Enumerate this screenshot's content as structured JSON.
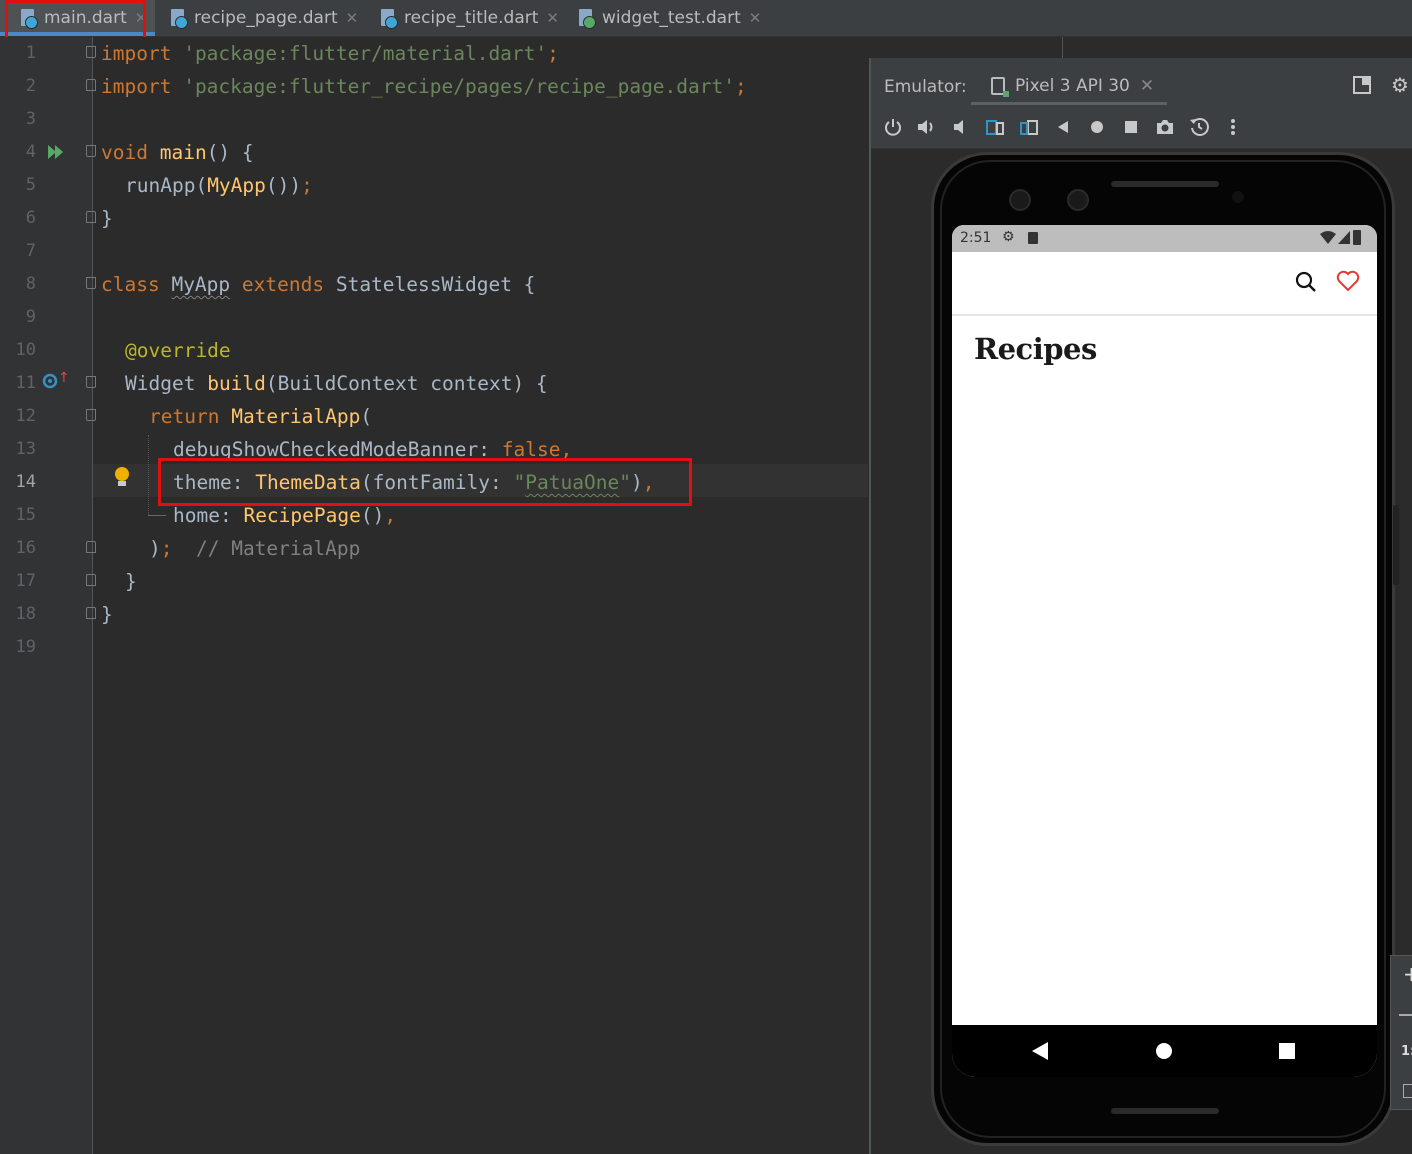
{
  "tabs": [
    {
      "label": "main.dart",
      "active": true
    },
    {
      "label": "recipe_page.dart",
      "active": false
    },
    {
      "label": "recipe_title.dart",
      "active": false
    },
    {
      "label": "widget_test.dart",
      "active": false
    }
  ],
  "editor": {
    "current_line_number": "14",
    "line_numbers": [
      "1",
      "2",
      "3",
      "4",
      "5",
      "6",
      "7",
      "8",
      "9",
      "10",
      "11",
      "12",
      "13",
      "14",
      "15",
      "16",
      "17",
      "18",
      "19"
    ],
    "code": {
      "l1_kw": "import",
      "l1_str": "'package:flutter/material.dart'",
      "l1_end": ";",
      "l2_kw": "import",
      "l2_str": "'package:flutter_recipe/pages/recipe_page.dart'",
      "l2_end": ";",
      "l4_kw": "void",
      "l4_fn": "main",
      "l4_rest": "() {",
      "l5_call": "runApp(",
      "l5_fn": "MyApp",
      "l5_rest": "())",
      "l5_end": ";",
      "l6": "}",
      "l8_kw": "class",
      "l8_name": "MyApp",
      "l8_kw2": "extends",
      "l8_rest": "StatelessWidget {",
      "l10_ann": "@override",
      "l11_type": "Widget",
      "l11_fn": "build",
      "l11_rest": "(BuildContext context) {",
      "l12_kw": "return",
      "l12_fn": "MaterialApp",
      "l12_rest": "(",
      "l13_key": "debugShowCheckedModeBanner:",
      "l13_val": "false",
      "l13_end": ",",
      "l14_key": "theme:",
      "l14_fn": "ThemeData",
      "l14_arg": "(fontFamily:",
      "l14_q1": "\"",
      "l14_str": "PatuaOne",
      "l14_q2": "\"",
      "l14_close": ")",
      "l14_end": ",",
      "l15_key": "home:",
      "l15_fn": "RecipePage",
      "l15_rest": "()",
      "l15_end": ",",
      "l16_paren": ")",
      "l16_semi": ";",
      "l16_cmt": "// MaterialApp",
      "l17": "}",
      "l18": "}"
    }
  },
  "emulator": {
    "label": "Emulator:",
    "device_tab": "Pixel 3 API 30",
    "toolbar_icons": [
      "power-icon",
      "volume-up-icon",
      "volume-down-icon",
      "rotate-left-icon",
      "rotate-right-icon",
      "back-icon",
      "home-icon",
      "overview-icon",
      "screenshot-icon",
      "snapshot-icon",
      "more-icon"
    ]
  },
  "phone": {
    "time": "2:51",
    "page_title": "Recipes",
    "search_icon": "search-icon",
    "heart_icon": "heart-icon",
    "heart_color": "#e53935"
  },
  "colors": {
    "highlight_box": "#e20f0f",
    "keyword": "#cc7832",
    "string": "#6a8759",
    "function": "#ffc66d"
  }
}
